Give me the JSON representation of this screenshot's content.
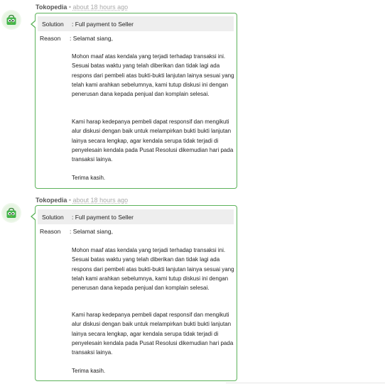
{
  "messages": [
    {
      "sender": "Tokopedia",
      "separator": "•",
      "time": "about 18 hours ago",
      "solution_label": "Solution",
      "solution_value": ": Full payment to Seller",
      "reason_label": "Reason",
      "reason_greeting": ": Selamat siang,",
      "paragraph_1": "Mohon maaf atas kendala yang terjadi terhadap transaksi ini. Sesuai batas waktu yang telah diberikan dan tidak lagi ada respons dari pembeli atas bukti-bukti lanjutan lainya sesuai yang telah kami arahkan sebelumnya, kami tutup diskusi ini dengan penerusan dana kepada penjual dan komplain selesai.",
      "paragraph_2": "Kami harap kedepanya pembeli dapat responsif dan mengikuti alur diskusi dengan baik untuk melampirkan bukti bukti lanjutan lainya secara lengkap, agar kendala serupa tidak terjadi di penyelesain kendala pada Pusat Resolusi dikemudian hari pada transaksi lainya.",
      "closing": "Terima kasih."
    },
    {
      "sender": "Tokopedia",
      "separator": "•",
      "time": "about 18 hours ago",
      "solution_label": "Solution",
      "solution_value": ": Full payment to Seller",
      "reason_label": "Reason",
      "reason_greeting": ": Selamat siang,",
      "paragraph_1": "Mohon maaf atas kendala yang terjadi terhadap transaksi ini. Sesuai batas waktu yang telah diberikan dan tidak lagi ada respons dari pembeli atas bukti-bukti lanjutan lainya sesuai yang telah kami arahkan sebelumnya, kami tutup diskusi ini dengan penerusan dana kepada penjual dan komplain selesai.",
      "paragraph_2": "Kami harap kedepanya pembeli dapat responsif dan mengikuti alur diskusi dengan baik untuk melampirkan bukti bukti lanjutan lainya secara lengkap, agar kendala serupa tidak terjadi di penyelesain kendala pada Pusat Resolusi dikemudian hari pada transaksi lainya.",
      "closing": "Terima kasih."
    }
  ],
  "colors": {
    "bubble_border": "#5db35b",
    "solution_row_bg": "#eeeeee",
    "avatar_green": "#42b549"
  },
  "icons": {
    "avatar": "tokopedia-bag-icon"
  }
}
